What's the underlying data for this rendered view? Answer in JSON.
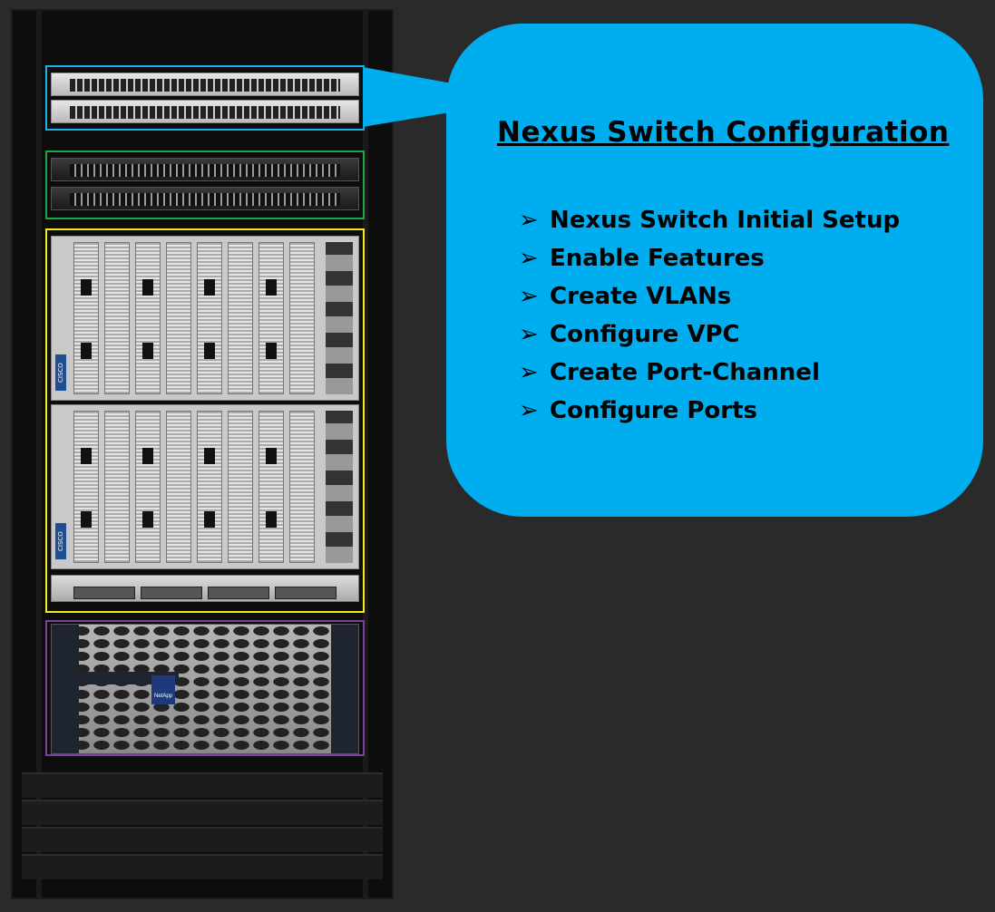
{
  "callout": {
    "title": "Nexus Switch Configuration",
    "steps": [
      "Nexus Switch Initial Setup",
      "Enable Features",
      "Create VLANs",
      "Configure VPC",
      "Create Port-Channel",
      "Configure Ports"
    ],
    "bullet_glyph": "➢",
    "color": "#00aeef"
  },
  "rack": {
    "highlight_colors": {
      "nexus_switches": "#1ab0e8",
      "fabric_interconnects": "#1fa84a",
      "compute": "#f4ea1a",
      "storage": "#7b3fa0"
    },
    "chassis_label": "CISCO",
    "storage_label": "NetApp"
  }
}
